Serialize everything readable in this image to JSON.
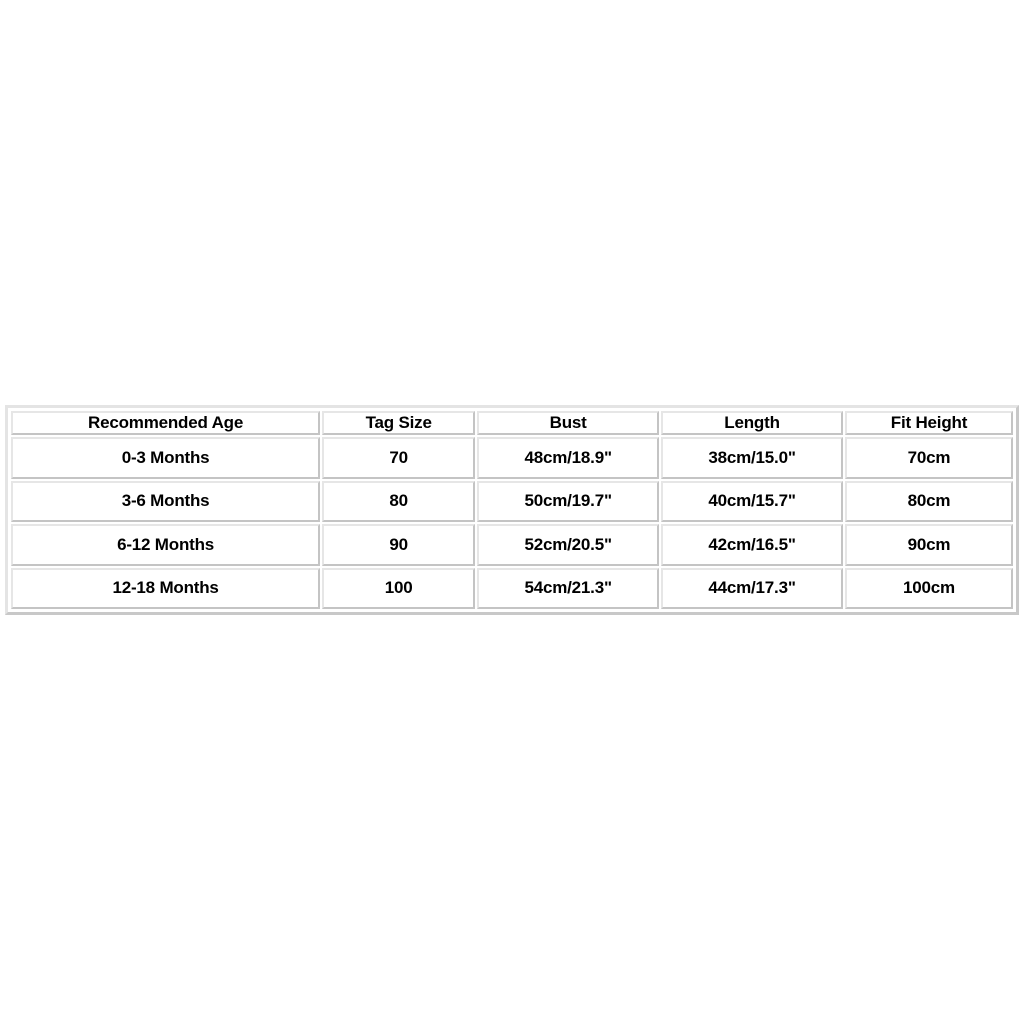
{
  "page": {
    "background_color": "#ffffff",
    "text_color": "#000000",
    "border_color": "#d0d0d0"
  },
  "size_chart": {
    "name": "baby-clothing-size-chart",
    "columns": [
      "Recommended Age",
      "Tag Size",
      "Bust",
      "Length",
      "Fit Height"
    ],
    "rows": [
      {
        "recommended_age": "0-3 Months",
        "tag_size": "70",
        "bust": "48cm/18.9\"",
        "length": "38cm/15.0\"",
        "fit_height": "70cm"
      },
      {
        "recommended_age": "3-6 Months",
        "tag_size": "80",
        "bust": "50cm/19.7\"",
        "length": "40cm/15.7\"",
        "fit_height": "80cm"
      },
      {
        "recommended_age": "6-12 Months",
        "tag_size": "90",
        "bust": "52cm/20.5\"",
        "length": "42cm/16.5\"",
        "fit_height": "90cm"
      },
      {
        "recommended_age": "12-18 Months",
        "tag_size": "100",
        "bust": "54cm/21.3\"",
        "length": "44cm/17.3\"",
        "fit_height": "100cm"
      }
    ]
  }
}
